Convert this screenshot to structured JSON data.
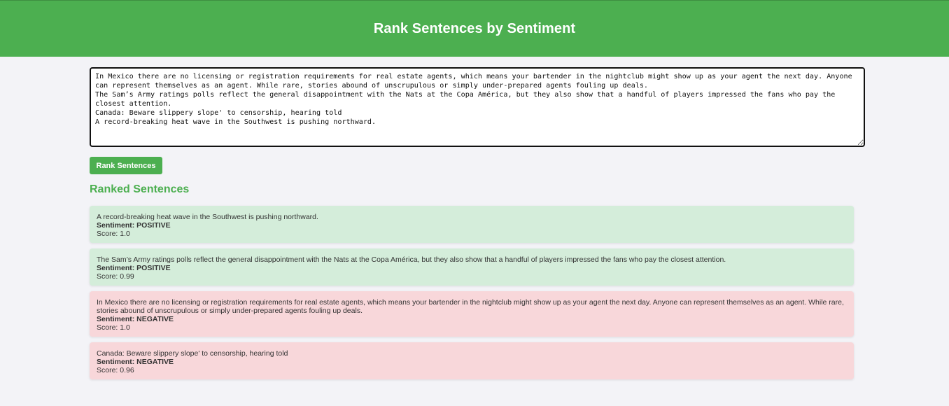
{
  "header": {
    "title": "Rank Sentences by Sentiment"
  },
  "input": {
    "value": "In Mexico there are no licensing or registration requirements for real estate agents, which means your bartender in the nightclub might show up as your agent the next day. Anyone can represent themselves as an agent. While rare, stories abound of unscrupulous or simply under-prepared agents fouling up deals.\nThe Sam’s Army ratings polls reflect the general disappointment with the Nats at the Copa América, but they also show that a handful of players impressed the fans who pay the closest attention.\nCanada: Beware slippery slope' to censorship, hearing told\nA record-breaking heat wave in the Southwest is pushing northward."
  },
  "button": {
    "label": "Rank Sentences"
  },
  "results": {
    "title": "Ranked Sentences",
    "sentiment_prefix": "Sentiment: ",
    "score_prefix": "Score: ",
    "items": [
      {
        "text": "A record-breaking heat wave in the Southwest is pushing northward.",
        "sentiment": "Sentiment: POSITIVE",
        "score": "Score: 1.0",
        "color": "#d4edda"
      },
      {
        "text": "The Sam’s Army ratings polls reflect the general disappointment with the Nats at the Copa América, but they also show that a handful of players impressed the fans who pay the closest attention.",
        "sentiment": "Sentiment: POSITIVE",
        "score": "Score: 0.99",
        "color": "#d4edda"
      },
      {
        "text": "In Mexico there are no licensing or registration requirements for real estate agents, which means your bartender in the nightclub might show up as your agent the next day. Anyone can represent themselves as an agent. While rare, stories abound of unscrupulous or simply under-prepared agents fouling up deals.",
        "sentiment": "Sentiment: NEGATIVE",
        "score": "Score: 1.0",
        "color": "#f8d7da"
      },
      {
        "text": "Canada: Beware slippery slope' to censorship, hearing told",
        "sentiment": "Sentiment: NEGATIVE",
        "score": "Score: 0.96",
        "color": "#f8d7da"
      }
    ]
  },
  "colors": {
    "accent": "#4caf50",
    "positive_bg": "#d4edda",
    "negative_bg": "#f8d7da"
  }
}
